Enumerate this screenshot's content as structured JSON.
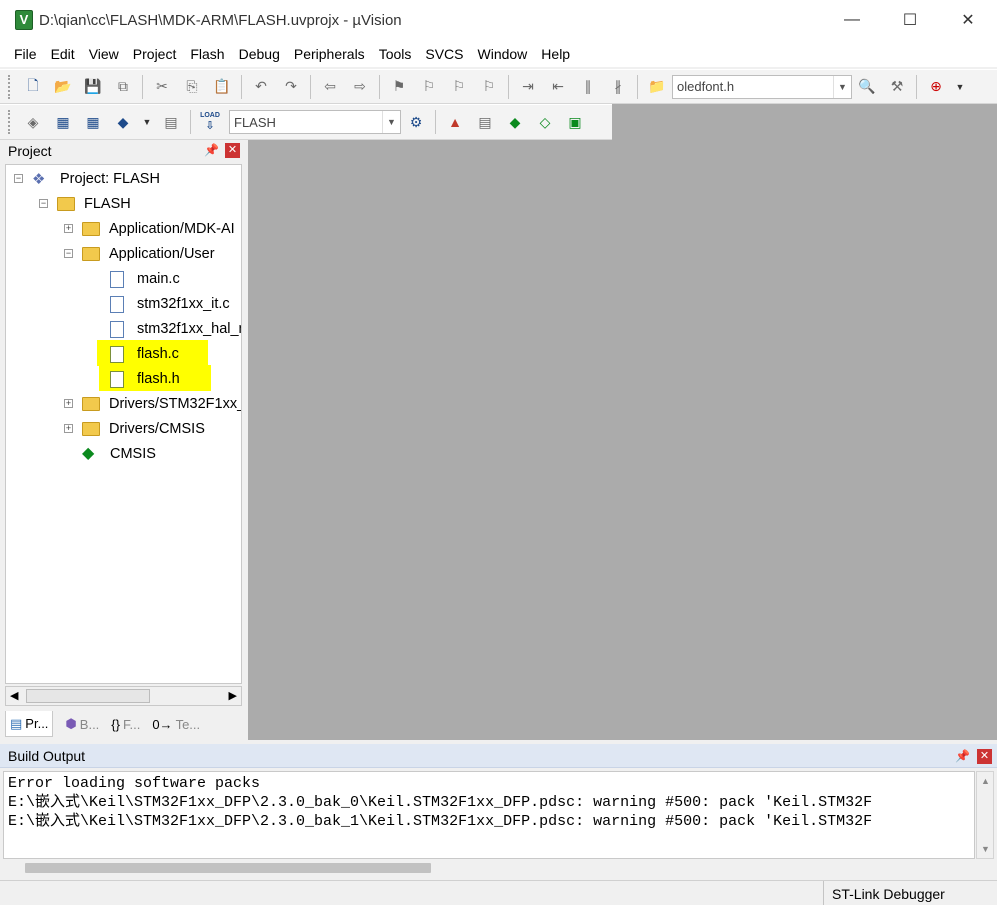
{
  "window": {
    "title": "D:\\qian\\cc\\FLASH\\MDK-ARM\\FLASH.uvprojx - µVision",
    "icon": "uvision-app-icon",
    "controls": {
      "minimize": "—",
      "maximize": "☐",
      "close": "✕"
    }
  },
  "menu": [
    "File",
    "Edit",
    "View",
    "Project",
    "Flash",
    "Debug",
    "Peripherals",
    "Tools",
    "SVCS",
    "Window",
    "Help"
  ],
  "toolbar1": {
    "find_combo": "oledfont.h"
  },
  "toolbar2": {
    "load_label": "LOAD",
    "target_combo": "FLASH"
  },
  "project_panel": {
    "title": "Project",
    "tree": {
      "root": "Project: FLASH",
      "target": "FLASH",
      "group_app_mdk": "Application/MDK-AI",
      "group_app_user": "Application/User",
      "file_main": "main.c",
      "file_it": "stm32f1xx_it.c",
      "file_hal": "stm32f1xx_hal_n",
      "file_flash_c": "flash.c",
      "file_flash_h": "flash.h",
      "group_drivers_stm": "Drivers/STM32F1xx_",
      "group_drivers_cmsis": "Drivers/CMSIS",
      "cmsis": "CMSIS"
    },
    "tabs": [
      "Pr...",
      "B...",
      "F...",
      "Te..."
    ]
  },
  "build_output": {
    "title": "Build Output",
    "line1": "Error loading software packs",
    "line2": "E:\\嵌入式\\Keil\\STM32F1xx_DFP\\2.3.0_bak_0\\Keil.STM32F1xx_DFP.pdsc: warning #500: pack 'Keil.STM32F",
    "line3": "E:\\嵌入式\\Keil\\STM32F1xx_DFP\\2.3.0_bak_1\\Keil.STM32F1xx_DFP.pdsc: warning #500: pack 'Keil.STM32F"
  },
  "status": {
    "debugger": "ST-Link Debugger"
  },
  "colors": {
    "highlight": "#ffff00",
    "workspace": "#ababab",
    "close_red": "#cc3333"
  }
}
